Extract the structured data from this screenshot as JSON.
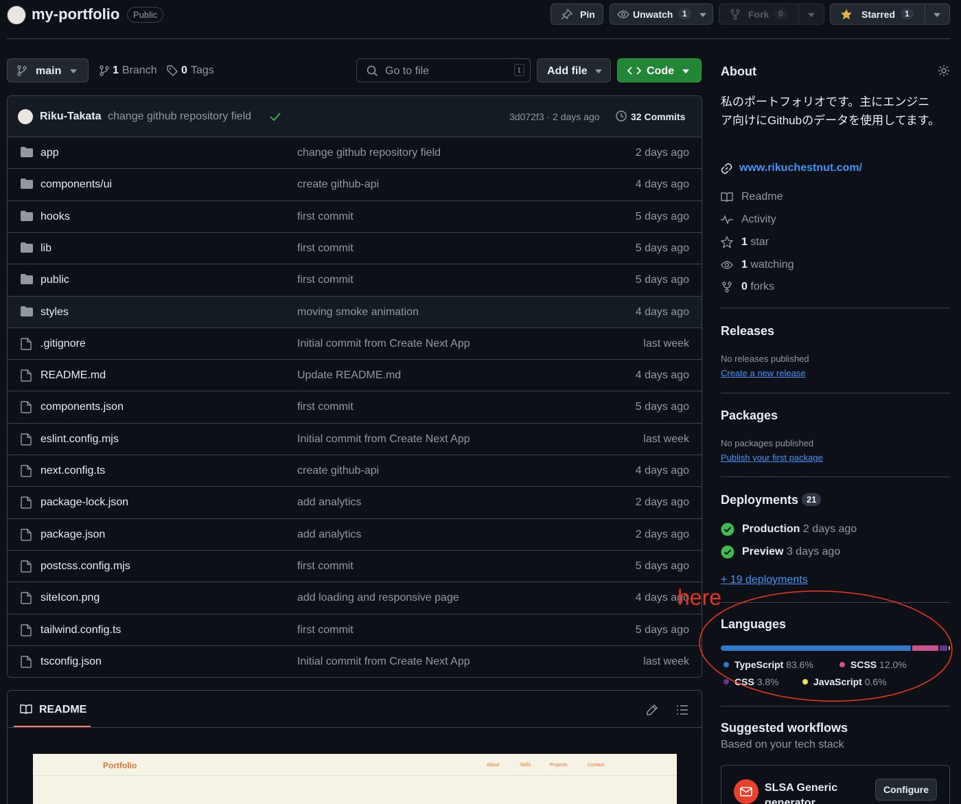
{
  "repo": {
    "name": "my-portfolio",
    "visibility": "Public"
  },
  "actions": {
    "pin": "Pin",
    "unwatch": "Unwatch",
    "unwatch_count": "1",
    "fork": "Fork",
    "fork_count": "0",
    "starred": "Starred",
    "star_count": "1"
  },
  "branchbar": {
    "branch": "main",
    "branches_count": "1",
    "branches_label": "Branch",
    "tags_count": "0",
    "tags_label": "Tags",
    "goto_placeholder": "Go to file",
    "goto_key": "t",
    "add_file": "Add file",
    "code": "Code"
  },
  "latest_commit": {
    "author": "Riku-Takata",
    "message": "change github repository field",
    "meta": "3d072f3 · 2 days ago",
    "commits_count": "32",
    "commits_label": "Commits"
  },
  "files": [
    {
      "type": "folder",
      "name": "app",
      "message": "change github repository field",
      "date": "2 days ago"
    },
    {
      "type": "folder",
      "name": "components/ui",
      "message": "create github-api",
      "date": "4 days ago"
    },
    {
      "type": "folder",
      "name": "hooks",
      "message": "first commit",
      "date": "5 days ago"
    },
    {
      "type": "folder",
      "name": "lib",
      "message": "first commit",
      "date": "5 days ago"
    },
    {
      "type": "folder",
      "name": "public",
      "message": "first commit",
      "date": "5 days ago"
    },
    {
      "type": "folder",
      "name": "styles",
      "message": "moving smoke animation",
      "date": "4 days ago"
    },
    {
      "type": "file",
      "name": ".gitignore",
      "message": "Initial commit from Create Next App",
      "date": "last week"
    },
    {
      "type": "file",
      "name": "README.md",
      "message": "Update README.md",
      "date": "4 days ago"
    },
    {
      "type": "file",
      "name": "components.json",
      "message": "first commit",
      "date": "5 days ago"
    },
    {
      "type": "file",
      "name": "eslint.config.mjs",
      "message": "Initial commit from Create Next App",
      "date": "last week"
    },
    {
      "type": "file",
      "name": "next.config.ts",
      "message": "create github-api",
      "date": "4 days ago"
    },
    {
      "type": "file",
      "name": "package-lock.json",
      "message": "add analytics",
      "date": "2 days ago"
    },
    {
      "type": "file",
      "name": "package.json",
      "message": "add analytics",
      "date": "2 days ago"
    },
    {
      "type": "file",
      "name": "postcss.config.mjs",
      "message": "first commit",
      "date": "5 days ago"
    },
    {
      "type": "file",
      "name": "siteIcon.png",
      "message": "add loading and responsive page",
      "date": "4 days ago"
    },
    {
      "type": "file",
      "name": "tailwind.config.ts",
      "message": "first commit",
      "date": "5 days ago"
    },
    {
      "type": "file",
      "name": "tsconfig.json",
      "message": "Initial commit from Create Next App",
      "date": "last week"
    }
  ],
  "readme": {
    "tab": "README",
    "preview": {
      "brand": "Portfolio",
      "nav": [
        "About",
        "Skills",
        "Projects",
        "Contact"
      ]
    }
  },
  "about": {
    "title": "About",
    "description": "私のポートフォリオです。主にエンジニア向けにGithubのデータを使用してます。",
    "website": "www.rikuchestnut.com/",
    "readme": "Readme",
    "activity": "Activity",
    "stars_count": "1",
    "stars_label": "star",
    "watching_count": "1",
    "watching_label": "watching",
    "forks_count": "0",
    "forks_label": "forks"
  },
  "releases": {
    "title": "Releases",
    "empty": "No releases published",
    "create_link": "Create a new release"
  },
  "packages": {
    "title": "Packages",
    "empty": "No packages published",
    "publish_link": "Publish your first package"
  },
  "deployments": {
    "title": "Deployments",
    "count": "21",
    "items": [
      {
        "env": "Production",
        "time": "2 days ago"
      },
      {
        "env": "Preview",
        "time": "3 days ago"
      }
    ],
    "more_link": "+ 19 deployments"
  },
  "languages": {
    "title": "Languages",
    "items": [
      {
        "name": "TypeScript",
        "percent_label": "83.6%",
        "percent": 83.6,
        "color": "#3178c6"
      },
      {
        "name": "SCSS",
        "percent_label": "12.0%",
        "percent": 12.0,
        "color": "#c6538c"
      },
      {
        "name": "CSS",
        "percent_label": "3.8%",
        "percent": 3.8,
        "color": "#663399"
      },
      {
        "name": "JavaScript",
        "percent_label": "0.6%",
        "percent": 0.6,
        "color": "#f1e05a"
      }
    ]
  },
  "annotation": {
    "text": "here",
    "color": "#e5341d"
  },
  "workflows": {
    "title": "Suggested workflows",
    "subtitle": "Based on your tech stack",
    "card": {
      "name": "SLSA Generic generator",
      "button": "Configure"
    }
  },
  "colors": {
    "code_button": "#238636",
    "link": "#4493f8",
    "success": "#3fb950",
    "star": "#e3b341"
  }
}
